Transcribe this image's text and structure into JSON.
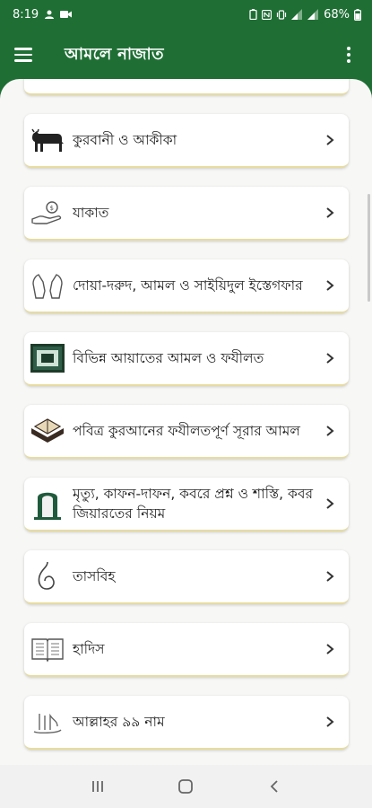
{
  "status_bar": {
    "time": "8:19",
    "battery": "68%"
  },
  "app_bar": {
    "title": "আমলে নাজাত"
  },
  "items": [
    {
      "label": "কুরবানী ও আকীকা",
      "icon": "cow-icon"
    },
    {
      "label": "যাকাত",
      "icon": "zakat-hand-coin-icon"
    },
    {
      "label": "দোয়া-দরুদ, আমল ও সাইয়িদুল ইস্তেগফার",
      "icon": "praying-hands-icon"
    },
    {
      "label": "বিভিন্ন আয়াতের আমল ও ফযীলত",
      "icon": "kaaba-frame-icon"
    },
    {
      "label": "পবিত্র কুরআনের ফযীলতপূর্ণ সূরার আমল",
      "icon": "open-quran-icon"
    },
    {
      "label": "মৃত্যু, কাফন-দাফন, কবরে প্রশ্ন ও শাস্তি, কবর জিয়ারতের নিয়ম",
      "icon": "grave-icon"
    },
    {
      "label": "তাসবিহ",
      "icon": "tasbih-icon"
    },
    {
      "label": "হাদিস",
      "icon": "book-icon"
    },
    {
      "label": "আল্লাহর ৯৯ নাম",
      "icon": "allah-calligraphy-icon"
    }
  ],
  "colors": {
    "primary": "#1f6f35",
    "card_accent": "#e7dca0",
    "background": "#f7f7f5"
  }
}
